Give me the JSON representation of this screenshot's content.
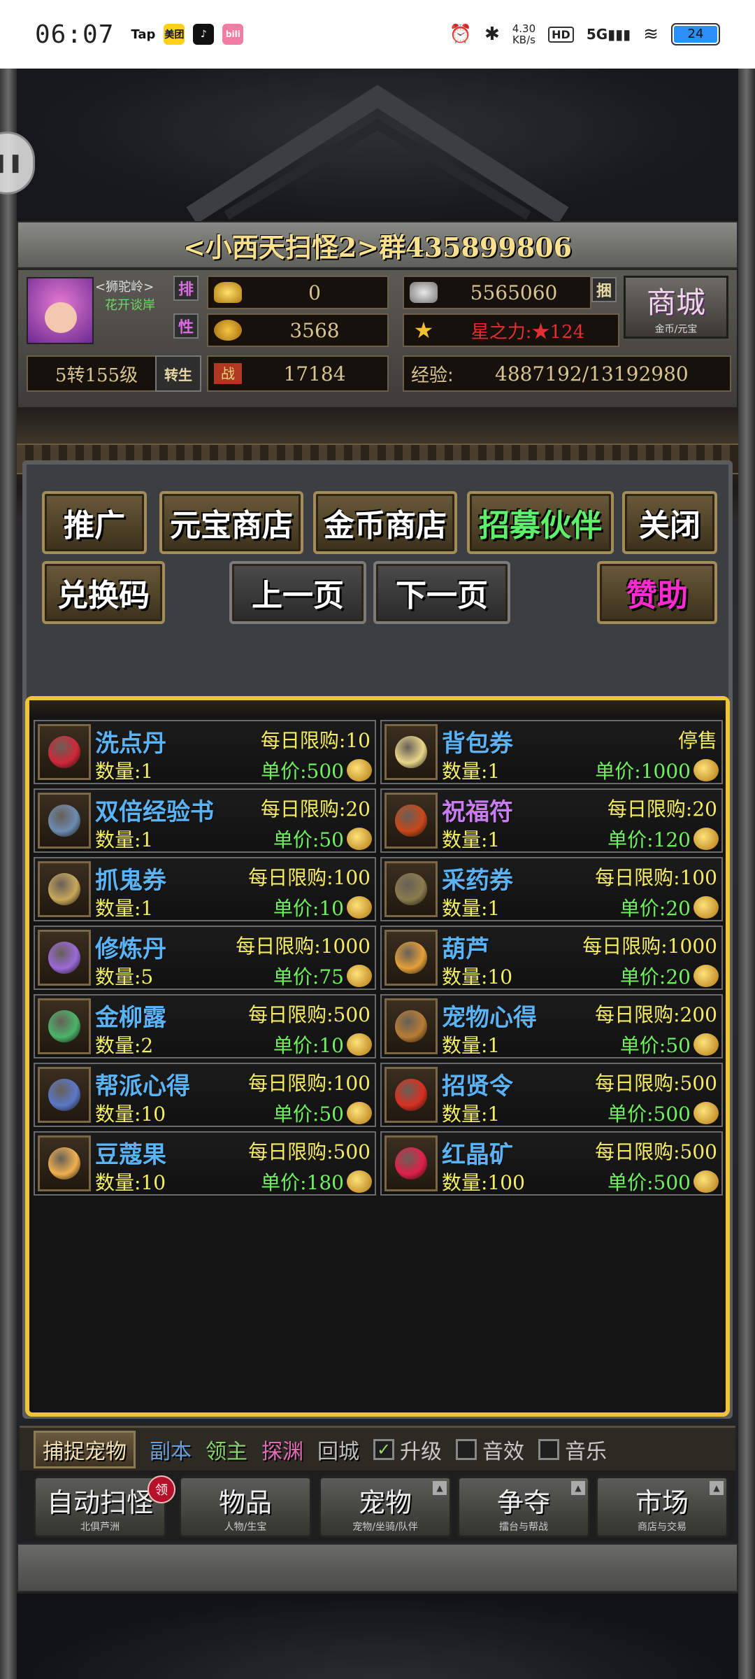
{
  "status_bar": {
    "time": "06:07",
    "apps": [
      "Tap",
      "美团",
      "♪",
      "bili"
    ],
    "net_speed": "4.30",
    "net_unit": "KB/s",
    "hd": "HD",
    "signal": "5G",
    "battery": "24"
  },
  "game": {
    "title": "<小西天扫怪2>群435899806",
    "player": {
      "name": "<狮驼岭>",
      "subtitle": "花开谈岸",
      "rank_tag": "排",
      "gender_tag": "性",
      "level": "5转155级",
      "level_btn": "转生"
    },
    "stats": {
      "yuanbao": "0",
      "silver": "5565060",
      "silver_btn": "捆",
      "gold": "3568",
      "star_power": "星之力:★124",
      "battle": "17184",
      "battle_icon": "战",
      "exp_label": "经验:",
      "exp": "4887192/13192980"
    },
    "shop_button": {
      "label": "商城",
      "sub": "金币/元宝"
    },
    "top_buttons": [
      "推广",
      "元宝商店",
      "金币商店",
      "招募伙伴",
      "关闭"
    ],
    "second_buttons": {
      "redeem": "兑换码",
      "prev": "上一页",
      "next": "下一页",
      "sponsor": "赞助"
    },
    "items": [
      {
        "name": "洗点丹",
        "qty": "数量:1",
        "limit": "每日限购:10",
        "price": "单价:500",
        "icon_color": "#d0283a"
      },
      {
        "name": "背包券",
        "qty": "数量:1",
        "limit": "停售",
        "price": "单价:1000",
        "icon_color": "#e9d58a"
      },
      {
        "name": "双倍经验书",
        "qty": "数量:1",
        "limit": "每日限购:20",
        "price": "单价:50",
        "icon_color": "#6d8bb0"
      },
      {
        "name": "祝福符",
        "qty": "数量:1",
        "limit": "每日限购:20",
        "price": "单价:120",
        "icon_color": "#c8481a"
      },
      {
        "name": "抓鬼券",
        "qty": "数量:1",
        "limit": "每日限购:100",
        "price": "单价:10",
        "icon_color": "#c9a75a"
      },
      {
        "name": "采药券",
        "qty": "数量:1",
        "limit": "每日限购:100",
        "price": "单价:20",
        "icon_color": "#8a7c4e"
      },
      {
        "name": "修炼丹",
        "qty": "数量:5",
        "limit": "每日限购:1000",
        "price": "单价:75",
        "icon_color": "#9a6ad8"
      },
      {
        "name": "葫芦",
        "qty": "数量:10",
        "limit": "每日限购:1000",
        "price": "单价:20",
        "icon_color": "#e4a03a"
      },
      {
        "name": "金柳露",
        "qty": "数量:2",
        "limit": "每日限购:500",
        "price": "单价:10",
        "icon_color": "#4bb46a"
      },
      {
        "name": "宠物心得",
        "qty": "数量:1",
        "limit": "每日限购:200",
        "price": "单价:50",
        "icon_color": "#b87c34"
      },
      {
        "name": "帮派心得",
        "qty": "数量:10",
        "limit": "每日限购:100",
        "price": "单价:50",
        "icon_color": "#5a78c8"
      },
      {
        "name": "招贤令",
        "qty": "数量:1",
        "limit": "每日限购:500",
        "price": "单价:500",
        "icon_color": "#d83020"
      },
      {
        "name": "豆蔻果",
        "qty": "数量:10",
        "limit": "每日限购:500",
        "price": "单价:180",
        "icon_color": "#f0b050"
      },
      {
        "name": "红晶矿",
        "qty": "数量:100",
        "limit": "每日限购:500",
        "price": "单价:500",
        "icon_color": "#e0204a"
      }
    ],
    "bottom_tabs": {
      "capture": "捕捉宠物",
      "dungeon": "副本",
      "boss": "领主",
      "explore": "探渊",
      "return": "回城"
    },
    "toggles": [
      {
        "label": "升级",
        "checked": "✓"
      },
      {
        "label": "音效",
        "checked": ""
      },
      {
        "label": "音乐",
        "checked": ""
      }
    ],
    "menu": [
      {
        "title": "自动扫怪",
        "sub": "北俱芦洲",
        "badge": "领"
      },
      {
        "title": "物品",
        "sub": "人物/生宝"
      },
      {
        "title": "宠物",
        "sub": "宠物/坐骑/队伴"
      },
      {
        "title": "争夺",
        "sub": "擂台与帮战"
      },
      {
        "title": "市场",
        "sub": "商店与交易"
      }
    ]
  }
}
